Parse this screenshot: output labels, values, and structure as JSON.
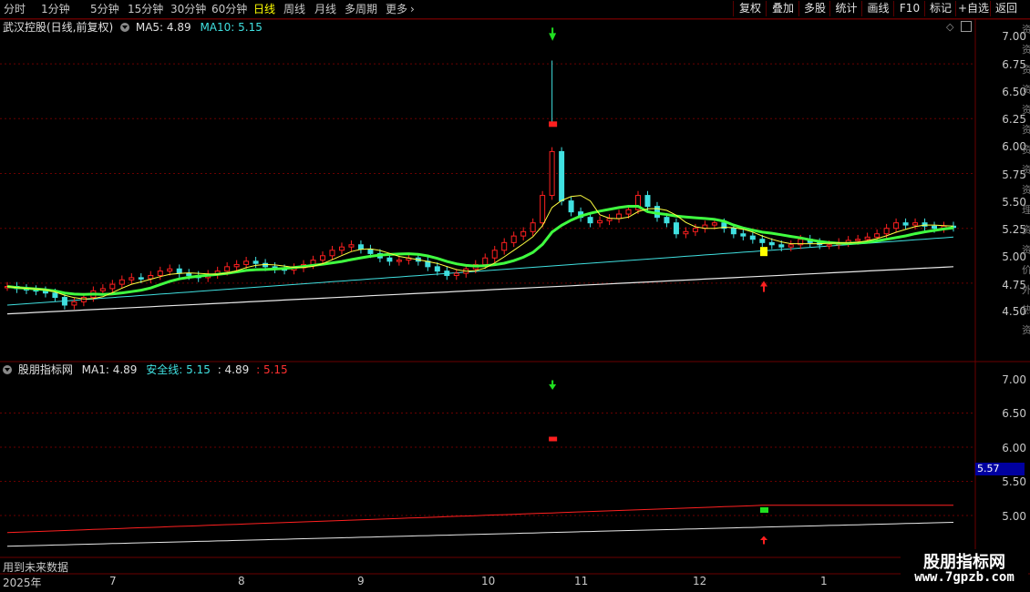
{
  "toolbar": {
    "periods": [
      "分时",
      "1分钟",
      "5分钟",
      "15分钟",
      "30分钟",
      "60分钟",
      "日线",
      "周线",
      "月线",
      "多周期",
      "更多"
    ],
    "active_period": "日线",
    "right_buttons": [
      "复权",
      "叠加",
      "多股",
      "统计",
      "画线",
      "F10",
      "标记",
      "+自选",
      "返回"
    ]
  },
  "main_panel": {
    "title": "武汉控股(日线,前复权)",
    "ma5_label": "MA5: 4.89",
    "ma10_label": "MA10: 5.15",
    "y_ticks": [
      "7.00",
      "6.75",
      "6.50",
      "6.25",
      "6.00",
      "5.75",
      "5.50",
      "5.25",
      "5.00",
      "4.75",
      "4.50"
    ]
  },
  "indicator_panel": {
    "title": "股朋指标网",
    "ma1_label": "MA1: 4.89",
    "safe_label": "安全线: 5.15",
    "v3_label": ": 4.89",
    "v4_label": ": 5.15",
    "y_ticks": [
      "7.00",
      "6.50",
      "6.00",
      "5.50",
      "5.00"
    ],
    "current_value": "5.57",
    "footer_note": "用到未来数据"
  },
  "x_axis": {
    "labels": [
      "2025年",
      "7",
      "8",
      "9",
      "10",
      "11",
      "12",
      "1"
    ]
  },
  "watermark": {
    "line1": "股朋指标网",
    "line2": "www.7gpzb.com"
  },
  "right_strip": {
    "text": "资资资资资资资资资理资资价外热资"
  },
  "colors": {
    "up": "#ff2020",
    "down": "#40e0e0",
    "ma5": "#ffff40",
    "ma10": "#40ff40",
    "safe_line": "#ff2020",
    "white_line": "#e8e8e8",
    "grid": "#6a0000"
  },
  "chart_data": {
    "type": "candlestick",
    "price_points": [
      4.72,
      4.7,
      4.69,
      4.68,
      4.66,
      4.62,
      4.55,
      4.58,
      4.62,
      4.68,
      4.7,
      4.74,
      4.78,
      4.8,
      4.79,
      4.82,
      4.86,
      4.88,
      4.84,
      4.82,
      4.8,
      4.83,
      4.86,
      4.9,
      4.92,
      4.95,
      4.93,
      4.9,
      4.88,
      4.87,
      4.89,
      4.92,
      4.96,
      5.0,
      5.05,
      5.08,
      5.1,
      5.06,
      5.02,
      4.98,
      4.95,
      4.96,
      4.98,
      4.95,
      4.9,
      4.86,
      4.82,
      4.84,
      4.88,
      4.92,
      4.98,
      5.05,
      5.12,
      5.18,
      5.22,
      5.3,
      5.55,
      5.95,
      5.5,
      5.4,
      5.35,
      5.3,
      5.32,
      5.34,
      5.38,
      5.42,
      5.55,
      5.45,
      5.35,
      5.3,
      5.2,
      5.22,
      5.25,
      5.28,
      5.3,
      5.25,
      5.2,
      5.18,
      5.15,
      5.12,
      5.1,
      5.08,
      5.1,
      5.15,
      5.12,
      5.1,
      5.1,
      5.12,
      5.14,
      5.15,
      5.17,
      5.2,
      5.25,
      5.3,
      5.28,
      5.3,
      5.27,
      5.25,
      5.27,
      5.26
    ],
    "safe_line_y_range": [
      4.75,
      5.15
    ],
    "signal_markers": [
      {
        "type": "down-arrow",
        "price": 7.0
      },
      {
        "type": "up-arrow",
        "price": 4.75
      }
    ]
  }
}
